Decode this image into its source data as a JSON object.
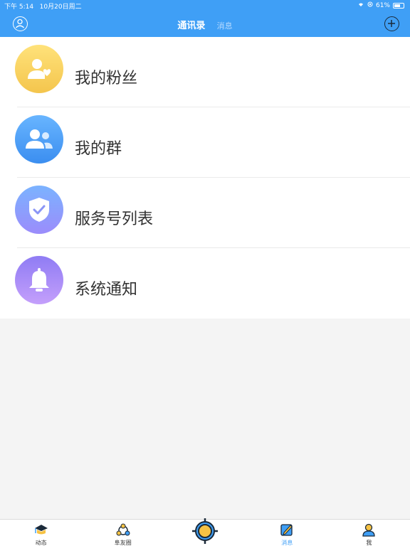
{
  "status": {
    "time": "下午 5:14",
    "date": "10月20日周二",
    "battery": "61%"
  },
  "header": {
    "tabs": [
      {
        "label": "通讯录",
        "active": true
      },
      {
        "label": "消息",
        "active": false
      }
    ]
  },
  "list": {
    "items": [
      {
        "label": "我的粉丝",
        "icon": "fans-icon"
      },
      {
        "label": "我的群",
        "icon": "group-icon"
      },
      {
        "label": "服务号列表",
        "icon": "shield-check-icon"
      },
      {
        "label": "系统通知",
        "icon": "bell-icon"
      }
    ]
  },
  "tabbar": {
    "items": [
      {
        "label": "动态",
        "icon": "graduation-cap-icon",
        "active": false
      },
      {
        "label": "阜友圈",
        "icon": "friends-circle-icon",
        "active": false
      },
      {
        "label": "",
        "icon": "target-icon",
        "active": false
      },
      {
        "label": "消息",
        "icon": "edit-note-icon",
        "active": true
      },
      {
        "label": "我",
        "icon": "person-icon",
        "active": false
      }
    ]
  },
  "colors": {
    "accent": "#3f9ff6"
  }
}
